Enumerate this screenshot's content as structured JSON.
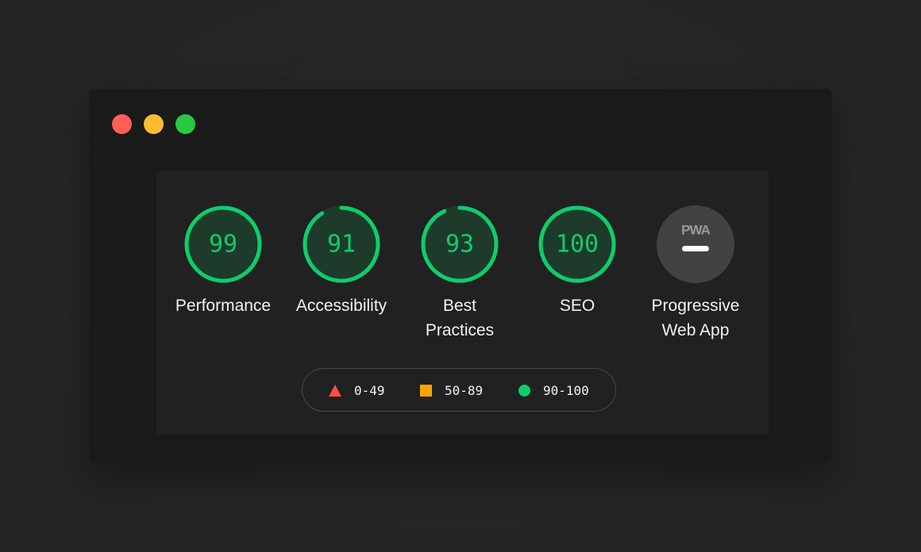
{
  "colors": {
    "pass": "#0cce6b",
    "average": "#ffa400",
    "fail": "#ff4e42",
    "pwa_badge": "#424242"
  },
  "window": {
    "controls": [
      "close",
      "minimize",
      "maximize"
    ]
  },
  "categories": [
    {
      "id": "performance",
      "score": "99",
      "label": "Performance"
    },
    {
      "id": "accessibility",
      "score": "91",
      "label": "Accessibility"
    },
    {
      "id": "best-practices",
      "score": "93",
      "label": "Best\nPractices"
    },
    {
      "id": "seo",
      "score": "100",
      "label": "SEO"
    },
    {
      "id": "pwa",
      "badge": "PWA",
      "label": "Progressive\nWeb App"
    }
  ],
  "legend": {
    "fail": "0-49",
    "average": "50-89",
    "pass": "90-100"
  }
}
